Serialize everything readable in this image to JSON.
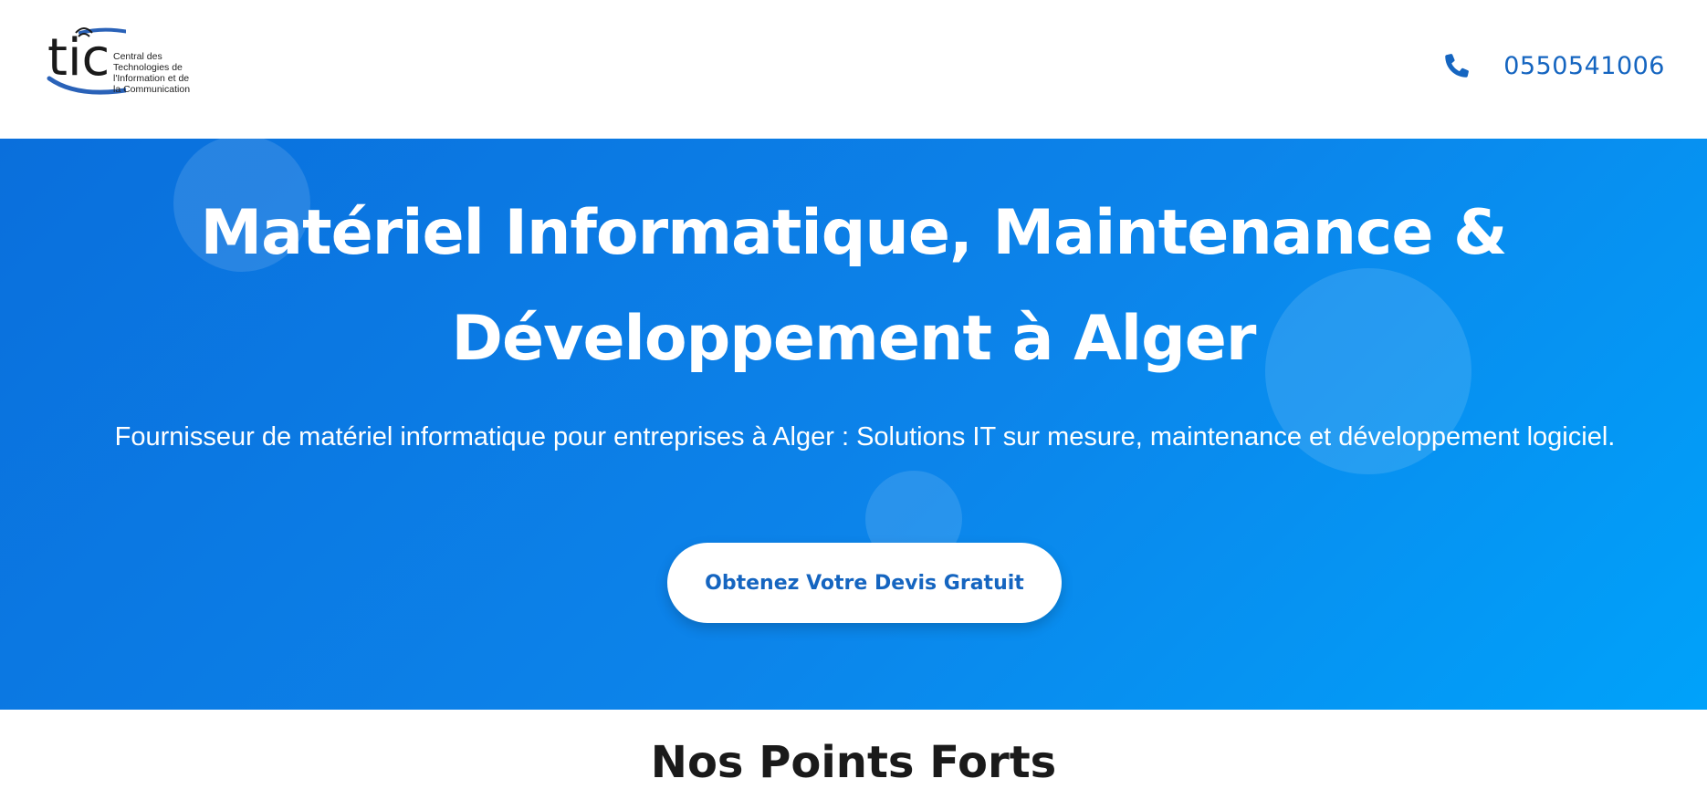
{
  "header": {
    "logo": {
      "wordmark": "tic",
      "tagline": "Central des\nTechnologies de\nl'Information et de\nla Communication"
    },
    "phone": {
      "icon": "phone-icon",
      "number": "0550541006"
    }
  },
  "hero": {
    "title": "Matériel Informatique, Maintenance & Développement à Alger",
    "subtitle": "Fournisseur de matériel informatique pour entreprises à Alger : Solutions IT sur mesure, maintenance et développement logiciel.",
    "cta_label": "Obtenez Votre Devis Gratuit"
  },
  "section": {
    "title": "Nos Points Forts"
  },
  "colors": {
    "brand_blue": "#1565c0",
    "hero_gradient_start": "#0a6fdc",
    "hero_gradient_end": "#00a2fa"
  }
}
